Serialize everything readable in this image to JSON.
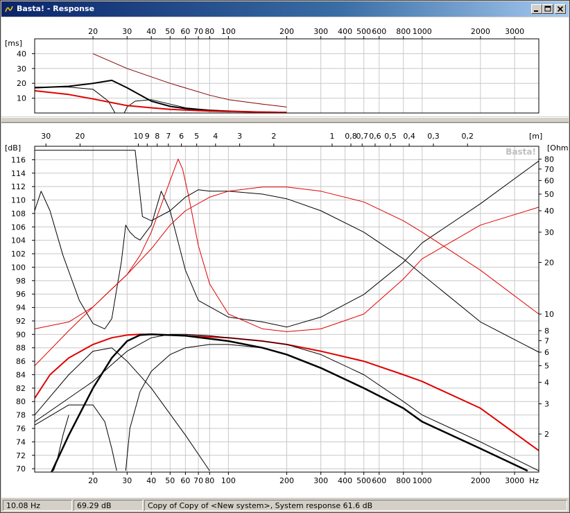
{
  "window": {
    "title": "Basta! - Response",
    "buttons": {
      "minimize": "minimize-icon",
      "maximize": "maximize-icon",
      "close": "close-icon"
    }
  },
  "freq_ticks": [
    {
      "v": 20,
      "t": "20"
    },
    {
      "v": 30,
      "t": "30"
    },
    {
      "v": 40,
      "t": "40"
    },
    {
      "v": 50,
      "t": "50"
    },
    {
      "v": 60,
      "t": "60"
    },
    {
      "v": 70,
      "t": "70"
    },
    {
      "v": 80,
      "t": "80"
    },
    {
      "v": 100,
      "t": "100"
    },
    {
      "v": 200,
      "t": "200"
    },
    {
      "v": 300,
      "t": "300"
    },
    {
      "v": 400,
      "t": "400"
    },
    {
      "v": 500,
      "t": "500"
    },
    {
      "v": 600,
      "t": "600"
    },
    {
      "v": 800,
      "t": "800"
    },
    {
      "v": 1000,
      "t": "1000"
    },
    {
      "v": 2000,
      "t": "2000"
    },
    {
      "v": 3000,
      "t": "3000"
    }
  ],
  "freq_unit": "Hz",
  "top_chart": {
    "unit": "[ms]",
    "y_ticks": [
      10,
      20,
      30,
      40
    ]
  },
  "wavelength_ticks": [
    {
      "f": 11.43,
      "t": "30"
    },
    {
      "f": 17.15,
      "t": "20"
    },
    {
      "f": 34.3,
      "t": "10"
    },
    {
      "f": 38.1,
      "t": "9"
    },
    {
      "f": 42.9,
      "t": "8"
    },
    {
      "f": 49,
      "t": "7"
    },
    {
      "f": 57.2,
      "t": "6"
    },
    {
      "f": 68.6,
      "t": "5"
    },
    {
      "f": 85.8,
      "t": "4"
    },
    {
      "f": 114.3,
      "t": "3"
    },
    {
      "f": 171.5,
      "t": "2"
    },
    {
      "f": 343,
      "t": "1"
    },
    {
      "f": 428.8,
      "t": "0,8"
    },
    {
      "f": 490,
      "t": "0,7"
    },
    {
      "f": 571.7,
      "t": "0,6"
    },
    {
      "f": 686,
      "t": "0,5"
    },
    {
      "f": 857.5,
      "t": "0,4"
    },
    {
      "f": 1143,
      "t": "0,3"
    },
    {
      "f": 1715,
      "t": "0,2"
    }
  ],
  "wavelength_unit": "[m]",
  "main_chart": {
    "db_unit": "[dB]",
    "ohm_unit": "[Ohm]",
    "db_ticks": [
      70,
      72,
      74,
      76,
      78,
      80,
      82,
      84,
      86,
      88,
      90,
      92,
      94,
      96,
      98,
      100,
      102,
      104,
      106,
      108,
      110,
      112,
      114,
      116
    ],
    "ohm_ticks": [
      2,
      3,
      4,
      5,
      6,
      7,
      8,
      10,
      20,
      30,
      40,
      50,
      60,
      70,
      80
    ],
    "watermark": "Basta!"
  },
  "colors": {
    "red": "#e00000",
    "black": "#000000",
    "grid": "#c8c8c8",
    "darkred": "#800000"
  },
  "chart_data": [
    {
      "type": "line",
      "title": "",
      "xlabel": "",
      "ylabel": "[ms]",
      "xscale": "log",
      "xlim": [
        10,
        4000
      ],
      "ylim": [
        0,
        50
      ],
      "grid": true,
      "series": [
        {
          "color": "#000000",
          "width": 2,
          "x": [
            10,
            15,
            20,
            25,
            30,
            40,
            50,
            60,
            80,
            100,
            150,
            200
          ],
          "y": [
            17,
            18,
            20,
            22,
            17,
            8,
            4.5,
            3,
            1.8,
            1.2,
            0.6,
            0.4
          ]
        },
        {
          "color": "#000000",
          "width": 1,
          "x": [
            10,
            15,
            20,
            24,
            26
          ],
          "y": [
            17.5,
            17.5,
            16,
            8,
            0
          ]
        },
        {
          "color": "#000000",
          "width": 1,
          "x": [
            29,
            30,
            33,
            40,
            50,
            60,
            80,
            100,
            150,
            200
          ],
          "y": [
            0,
            4,
            8,
            9,
            6,
            3.5,
            2,
            1.3,
            0.6,
            0.4
          ]
        },
        {
          "color": "#e00000",
          "width": 2,
          "x": [
            10,
            15,
            20,
            25,
            30,
            40,
            50,
            60,
            80,
            100,
            150,
            200
          ],
          "y": [
            15,
            12.5,
            9.5,
            7,
            5,
            3.5,
            2.5,
            2,
            1.3,
            1,
            0.6,
            0.4
          ]
        },
        {
          "color": "#800000",
          "width": 1,
          "x": [
            20,
            30,
            50,
            80,
            100,
            150,
            200
          ],
          "y": [
            40,
            30,
            20,
            12,
            9,
            6,
            4
          ]
        }
      ]
    },
    {
      "type": "line",
      "title": "",
      "xlabel": "Hz",
      "ylabel": "[dB]",
      "y2label": "[Ohm]",
      "xscale": "log",
      "xlim": [
        10,
        4000
      ],
      "ylim": [
        69.5,
        118
      ],
      "y2scale": "log",
      "grid": true,
      "series": [
        {
          "axis": "db",
          "color": "#e00000",
          "width": 2,
          "x": [
            10,
            12,
            15,
            20,
            25,
            30,
            35,
            40,
            60,
            100,
            150,
            200,
            300,
            500,
            800,
            1000,
            2000,
            4000
          ],
          "y": [
            80.5,
            84,
            86.5,
            88.5,
            89.5,
            89.9,
            90,
            90,
            89.8,
            89.5,
            89,
            88.5,
            87.5,
            86,
            84,
            83,
            79,
            72.7
          ]
        },
        {
          "axis": "db",
          "color": "#000000",
          "width": 2.5,
          "x": [
            10,
            12,
            15,
            20,
            25,
            30,
            35,
            40,
            60,
            100,
            150,
            200,
            300,
            500,
            800,
            1000,
            2000,
            3500
          ],
          "y": [
            64,
            69,
            75,
            82,
            86.5,
            89,
            89.9,
            90,
            89.8,
            89,
            88,
            87,
            85,
            82,
            79,
            77,
            73,
            69.7
          ]
        },
        {
          "axis": "db",
          "color": "#000000",
          "width": 1,
          "x": [
            10,
            15,
            20,
            25,
            30,
            40,
            60,
            80
          ],
          "y": [
            78,
            84,
            87.5,
            88,
            86,
            82,
            75,
            69.7
          ]
        },
        {
          "axis": "db",
          "color": "#000000",
          "width": 1,
          "x": [
            10,
            15,
            20,
            23,
            25,
            26.5
          ],
          "y": [
            76.5,
            79.5,
            79.5,
            77,
            73,
            69.7
          ]
        },
        {
          "axis": "db",
          "color": "#000000",
          "width": 1,
          "x": [
            29.5,
            31,
            35,
            40,
            50,
            60,
            80,
            100,
            150,
            200
          ],
          "y": [
            69.7,
            76,
            81.5,
            84.5,
            87,
            88,
            88.5,
            88.5,
            88,
            87
          ]
        },
        {
          "axis": "db",
          "color": "#000000",
          "width": 1,
          "x": [
            10,
            15,
            20,
            25,
            30,
            40,
            50,
            60,
            80,
            100,
            150,
            200,
            300,
            500,
            800,
            1000,
            2000,
            4000
          ],
          "y": [
            77,
            80.5,
            83,
            85.5,
            87.5,
            89.5,
            90,
            90,
            89.8,
            89.5,
            89,
            88.5,
            87,
            84,
            80,
            78,
            74,
            69.7
          ]
        },
        {
          "axis": "db",
          "color": "#000000",
          "width": 1,
          "x": [
            12.5,
            13,
            14,
            15
          ],
          "y": [
            69.7,
            71,
            75,
            78
          ]
        },
        {
          "axis": "ohm",
          "color": "#000000",
          "width": 1,
          "x": [
            10,
            10.8,
            12,
            14,
            17,
            20,
            23,
            25,
            26.5,
            28,
            29.5,
            31,
            33,
            35,
            40,
            45,
            50,
            60,
            70,
            100,
            150,
            200,
            300,
            500,
            800,
            1000,
            2000,
            4000
          ],
          "y": [
            40,
            52,
            40,
            22,
            12,
            8.8,
            8.2,
            9.4,
            14,
            20,
            33,
            30,
            28,
            27,
            33,
            52,
            40,
            18,
            12,
            9.6,
            9,
            8.4,
            9.6,
            13,
            20,
            26,
            44,
            78
          ]
        },
        {
          "axis": "ohm",
          "color": "#000000",
          "width": 1,
          "x": [
            10,
            15,
            20,
            25,
            30,
            33,
            36,
            40,
            50,
            60,
            70,
            80,
            100,
            150,
            200,
            300,
            500,
            800,
            1000,
            2000,
            4000
          ],
          "y": [
            90,
            90,
            90,
            90,
            90,
            90,
            37,
            35,
            40,
            48,
            53,
            52,
            52,
            50,
            47,
            40,
            30,
            21,
            17,
            9,
            6
          ]
        },
        {
          "axis": "ohm",
          "color": "#e00000",
          "width": 1,
          "x": [
            10,
            15,
            20,
            25,
            30,
            35,
            40,
            50,
            55,
            58,
            62,
            70,
            80,
            100,
            150,
            200,
            300,
            500,
            800,
            1000,
            2000,
            4000
          ],
          "y": [
            8.2,
            9,
            11,
            14,
            17,
            22,
            30,
            60,
            80,
            70,
            50,
            25,
            15,
            10,
            8.2,
            7.9,
            8.2,
            10,
            16,
            21,
            33,
            42
          ]
        },
        {
          "axis": "ohm",
          "color": "#e00000",
          "width": 1,
          "x": [
            10,
            15,
            20,
            25,
            30,
            40,
            50,
            60,
            80,
            100,
            150,
            200,
            300,
            500,
            800,
            1000,
            2000,
            4000
          ],
          "y": [
            5,
            8,
            11,
            14,
            17,
            24,
            33,
            40,
            48,
            52,
            55,
            55,
            52,
            45,
            35,
            30,
            18,
            10
          ]
        }
      ]
    }
  ],
  "status": {
    "freq": "10.08 Hz",
    "level": "69.29 dB",
    "message": "Copy of Copy of <New system>, System response 61.6 dB"
  }
}
